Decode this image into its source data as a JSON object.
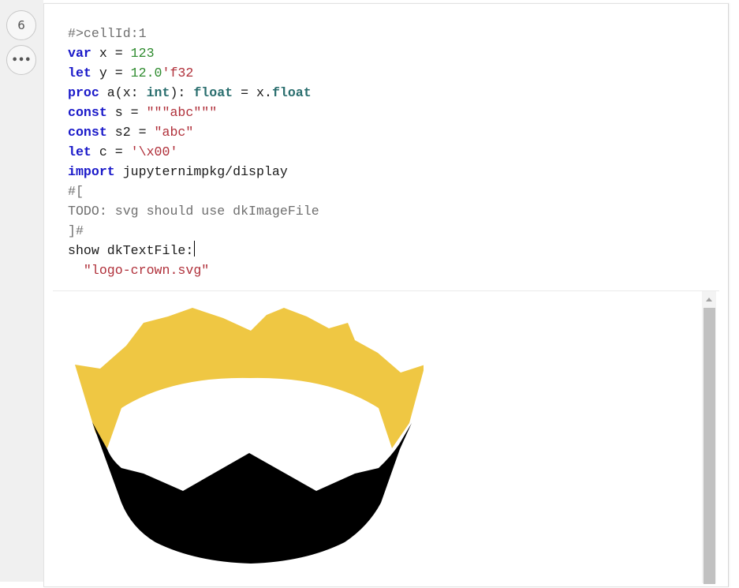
{
  "cell": {
    "execution_count": "6",
    "more_icon": "ellipsis-icon",
    "code_lines": [
      [
        {
          "t": "#>cellId:1",
          "c": "com"
        }
      ],
      [
        {
          "t": "var",
          "c": "kw"
        },
        {
          "t": " x = ",
          "c": "plain"
        },
        {
          "t": "123",
          "c": "num"
        }
      ],
      [
        {
          "t": "let",
          "c": "kw"
        },
        {
          "t": " y = ",
          "c": "plain"
        },
        {
          "t": "12.0",
          "c": "num"
        },
        {
          "t": "'f32",
          "c": "str"
        }
      ],
      [
        {
          "t": "proc",
          "c": "kw"
        },
        {
          "t": " a(x: ",
          "c": "plain"
        },
        {
          "t": "int",
          "c": "type"
        },
        {
          "t": "): ",
          "c": "plain"
        },
        {
          "t": "float",
          "c": "type"
        },
        {
          "t": " = x.",
          "c": "plain"
        },
        {
          "t": "float",
          "c": "type"
        }
      ],
      [
        {
          "t": "const",
          "c": "kw"
        },
        {
          "t": " s = ",
          "c": "plain"
        },
        {
          "t": "\"\"\"abc\"\"\"",
          "c": "str"
        }
      ],
      [
        {
          "t": "const",
          "c": "kw"
        },
        {
          "t": " s2 = ",
          "c": "plain"
        },
        {
          "t": "\"abc\"",
          "c": "str"
        }
      ],
      [
        {
          "t": "let",
          "c": "kw"
        },
        {
          "t": " c = ",
          "c": "plain"
        },
        {
          "t": "'\\x00'",
          "c": "str"
        }
      ],
      [
        {
          "t": "import",
          "c": "kw"
        },
        {
          "t": " jupyternimpkg/display",
          "c": "plain"
        }
      ],
      [
        {
          "t": "#[",
          "c": "com"
        }
      ],
      [
        {
          "t": "TODO: svg should use dkImageFile",
          "c": "com"
        }
      ],
      [
        {
          "t": "]#",
          "c": "com"
        }
      ],
      [
        {
          "t": "show dkTextFile:",
          "c": "plain"
        },
        {
          "t": "",
          "c": "cursor"
        }
      ],
      [
        {
          "t": "  ",
          "c": "plain"
        },
        {
          "t": "\"logo-crown.svg\"",
          "c": "str"
        }
      ]
    ]
  },
  "output": {
    "image_icon": "crown-logo-icon",
    "colors": {
      "gold": "#efc743",
      "black": "#000000"
    }
  },
  "scrollbar": {
    "icon": "scroll-up-arrow-icon"
  }
}
